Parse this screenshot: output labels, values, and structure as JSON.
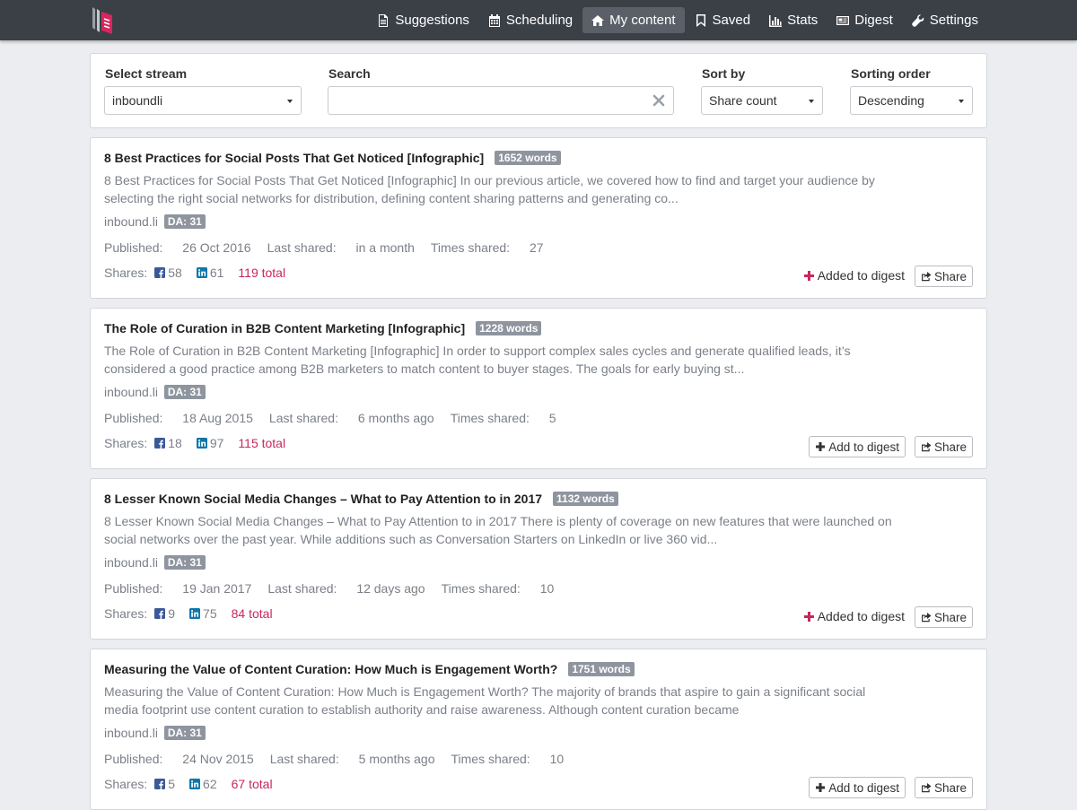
{
  "nav": {
    "items": [
      {
        "label": "Suggestions",
        "icon": "file-icon"
      },
      {
        "label": "Scheduling",
        "icon": "calendar-icon"
      },
      {
        "label": "My content",
        "icon": "home-icon",
        "active": true
      },
      {
        "label": "Saved",
        "icon": "bookmark-icon"
      },
      {
        "label": "Stats",
        "icon": "bar-chart-icon"
      },
      {
        "label": "Digest",
        "icon": "newspaper-icon"
      },
      {
        "label": "Settings",
        "icon": "wrench-icon"
      }
    ]
  },
  "filters": {
    "stream_label": "Select stream",
    "stream_value": "inboundli",
    "search_label": "Search",
    "search_value": "",
    "sort_label": "Sort by",
    "sort_value": "Share count",
    "order_label": "Sorting order",
    "order_value": "Descending"
  },
  "labels": {
    "published": "Published:",
    "last_shared": "Last shared:",
    "times_shared": "Times shared:",
    "shares": "Shares:",
    "added": "Added to digest",
    "add": "Add to digest",
    "share": "Share"
  },
  "colors": {
    "accent": "#c7275d",
    "navbar": "#3b3f46",
    "facebook": "#3b5998",
    "linkedin": "#0e76a8"
  },
  "articles": [
    {
      "title": "8 Best Practices for Social Posts That Get Noticed [Infographic]",
      "words": "1652 words",
      "excerpt": "8 Best Practices for Social Posts That Get Noticed [Infographic] In our previous article, we covered how to find and target your audience by selecting the right social networks for distribution, defining content sharing patterns and generating co...",
      "domain": "inbound.li",
      "da": "DA: 31",
      "published": "26 Oct 2016",
      "last_shared": "in a month",
      "times_shared": "27",
      "facebook": "58",
      "linkedin": "61",
      "total": "119 total",
      "in_digest": true
    },
    {
      "title": "The Role of Curation in B2B Content Marketing [Infographic]",
      "words": "1228 words",
      "excerpt": "The Role of Curation in B2B Content Marketing [Infographic] In order to support complex sales cycles and generate qualified leads, it’s considered a good practice among B2B marketers to match content to buyer stages. The goals for early buying st...",
      "domain": "inbound.li",
      "da": "DA: 31",
      "published": "18 Aug 2015",
      "last_shared": "6 months ago",
      "times_shared": "5",
      "facebook": "18",
      "linkedin": "97",
      "total": "115 total",
      "in_digest": false
    },
    {
      "title": "8 Lesser Known Social Media Changes – What to Pay Attention to in 2017",
      "words": "1132 words",
      "excerpt": "8 Lesser Known Social Media Changes – What to Pay Attention to in 2017 There is plenty of coverage on new features that were launched on social networks over the past year. While additions such as Conversation Starters on LinkedIn or live 360 vid...",
      "domain": "inbound.li",
      "da": "DA: 31",
      "published": "19 Jan 2017",
      "last_shared": "12 days ago",
      "times_shared": "10",
      "facebook": "9",
      "linkedin": "75",
      "total": "84 total",
      "in_digest": true
    },
    {
      "title": "Measuring the Value of Content Curation: How Much is Engagement Worth?",
      "words": "1751 words",
      "excerpt": "Measuring the Value of Content Curation: How Much is Engagement Worth? The majority of brands that aspire to gain a significant social media footprint use content curation to establish authority and raise awareness. Although content curation became",
      "domain": "inbound.li",
      "da": "DA: 31",
      "published": "24 Nov 2015",
      "last_shared": "5 months ago",
      "times_shared": "10",
      "facebook": "5",
      "linkedin": "62",
      "total": "67 total",
      "in_digest": false
    }
  ]
}
